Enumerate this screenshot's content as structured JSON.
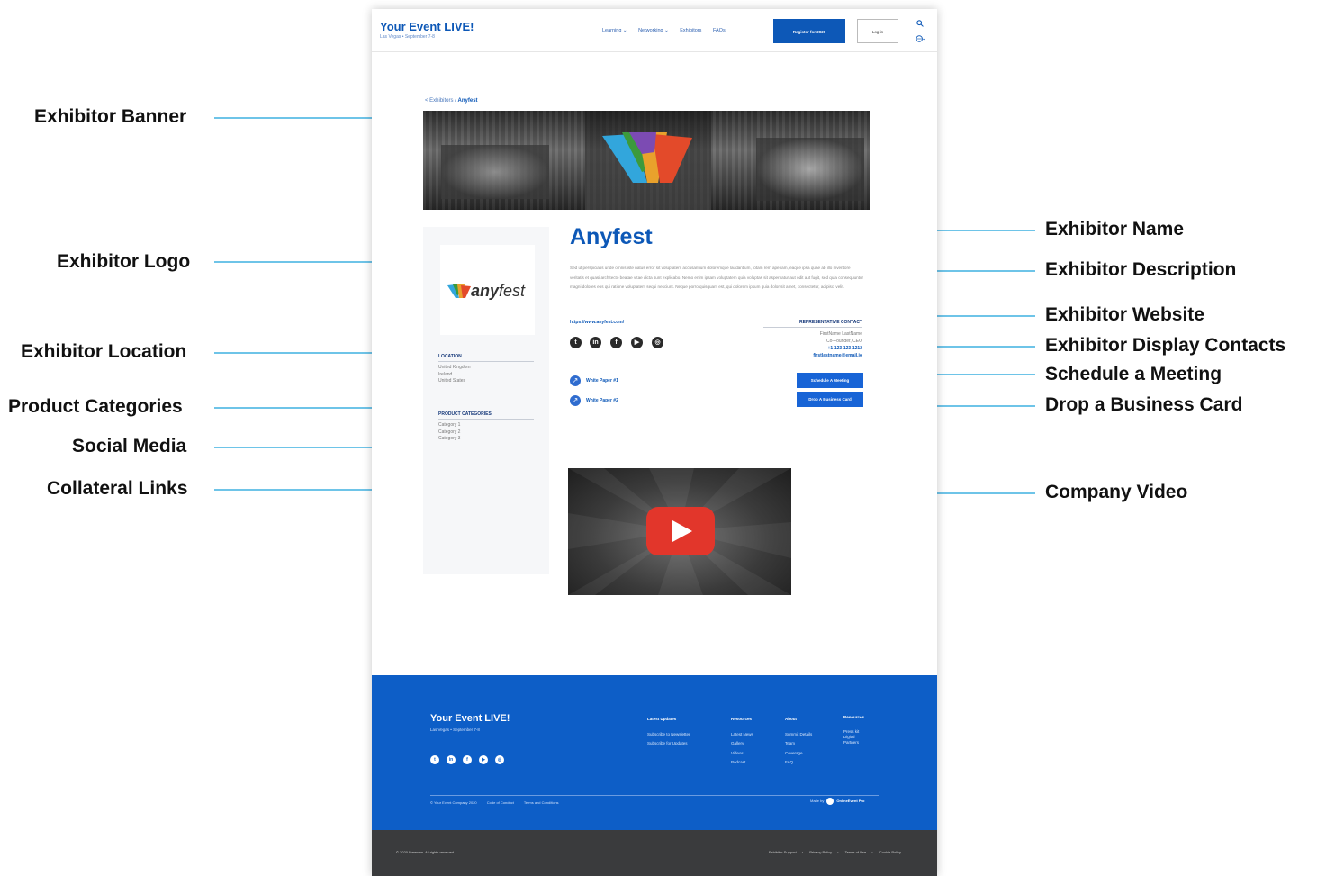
{
  "header": {
    "brand_title": "Your Event LIVE!",
    "brand_subtitle": "Las Vegas • September 7-8",
    "nav": [
      "Learning ⌄",
      "Networking ⌄",
      "Exhibitors",
      "FAQs"
    ],
    "register_label": "Register for 2020",
    "login_label": "Log in"
  },
  "breadcrumb": {
    "parent": "< Exhibitors /",
    "current": "Anyfest"
  },
  "exhibitor": {
    "name": "Anyfest",
    "logo_bold": "any",
    "logo_light": "fest",
    "description": "Sed ut perspiciatis unde omnis iste natus error sit voluptatem accusantium doloremque laudantium, totam rem aperiam, eaque ipsa quae ab illo inventore veritatis et quasi architecto beatae vitae dicta sunt explicabo. Nemo enim ipsam voluptatem quia voluptas sit aspernatur aut odit aut fugit, sed quia consequuntur magni dolores eos qui ratione voluptatem sequi nesciunt. Neque porro quisquam est, qui dolorem ipsum quia dolor sit amet, consectetur, adipisci velit.",
    "website": "https://www.anyfest.com/",
    "location_label": "LOCATION",
    "locations": [
      "United Kingdom",
      "Ireland",
      "United States"
    ],
    "categories_label": "PRODUCT CATEGORIES",
    "categories": [
      "Category 1",
      "Category 2",
      "Category 3"
    ],
    "social": [
      "twitter-icon",
      "linkedin-icon",
      "facebook-icon",
      "youtube-icon",
      "instagram-icon"
    ],
    "collateral": [
      "White Paper #1",
      "White Paper #2"
    ],
    "rep_label": "REPRESENTATIVE CONTACT",
    "rep_name": "FirstName LastName",
    "rep_title": "Co-Founder, CEO",
    "rep_phone": "+1-123-123-1212",
    "rep_email": "firstlastname@email.io",
    "schedule_label": "Schedule A Meeting",
    "drop_card_label": "Drop A Business Card"
  },
  "footer": {
    "title": "Your Event LIVE!",
    "subtitle": "Las Vegas • September 7-8",
    "columns": [
      {
        "heading": "Latest Updates",
        "items": [
          "Subscribe to Newsletter",
          "Subscribe for Updates"
        ]
      },
      {
        "heading": "Resources",
        "items": [
          "Latest News",
          "Gallery",
          "Videos",
          "Podcast"
        ]
      },
      {
        "heading": "About",
        "items": [
          "Summit Details",
          "Team",
          "Coverage",
          "FAQ"
        ]
      },
      {
        "heading": "Resources",
        "items": [
          "Press kit",
          "Digital",
          "Partners"
        ]
      }
    ],
    "legal": [
      "© Your Event Company 2020",
      "Code of Conduct",
      "Terms and Conditions"
    ],
    "made_with_prefix": "Made by",
    "made_with": "OnlineEvent Pro",
    "bottom_left": "© 2020 Freeman. All rights reserved.",
    "bottom_links": [
      "Exhibitor Support",
      "Privacy Policy",
      "Terms of Use",
      "Cookie Policy"
    ]
  },
  "annotations": {
    "banner": "Exhibitor Banner",
    "logo": "Exhibitor Logo",
    "location": "Exhibitor Location",
    "categories": "Product Categories",
    "social": "Social Media",
    "collateral": "Collateral Links",
    "name": "Exhibitor Name",
    "description": "Exhibitor Description",
    "website": "Exhibitor Website",
    "contacts": "Exhibitor Display Contacts",
    "meeting": "Schedule a Meeting",
    "card": "Drop a Business Card",
    "video": "Company Video"
  },
  "colors": {
    "brand_blue": "#0d58b7",
    "button_blue": "#1864d6",
    "annotation_line": "#3fb0e0",
    "bottom_bar": "#3a3b3d",
    "youtube_red": "#e2362b"
  }
}
